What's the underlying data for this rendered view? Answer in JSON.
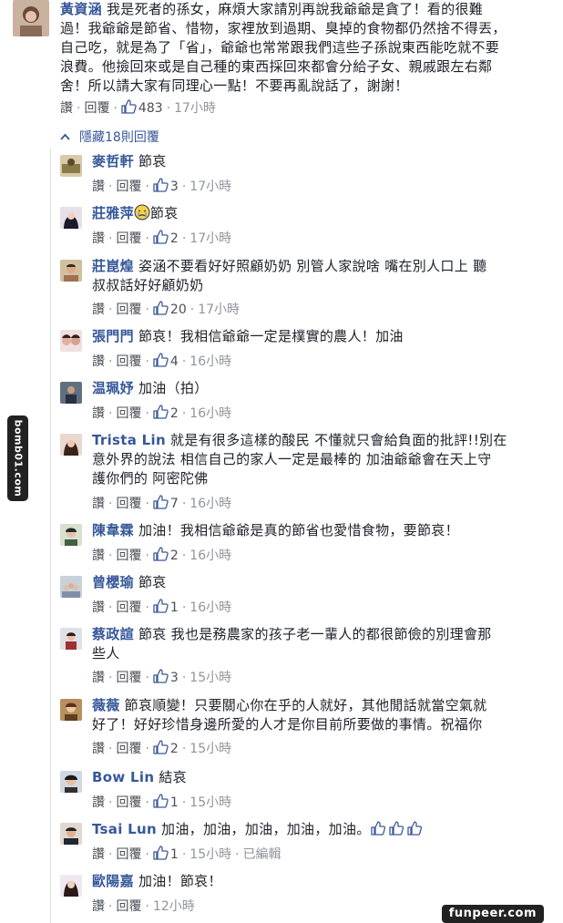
{
  "top_comment": {
    "name": "黃資涵",
    "text_line1": " 我是死者的孫女，麻煩大家請別再說我爺爺是貪了！看的很難",
    "text_line2": "過！我爺爺是節省、惜物，家裡放到過期、臭掉的食物都仍然捨不得丟，",
    "text_line3": "自己吃，就是為了「省」，爺爺也常常跟我們這些子孫說東西能吃就不要",
    "text_line4": "浪費。他撿回來或是自己種的東西採回來都會分給子女、親戚跟左右鄰",
    "text_line5": "舍！所以請大家有同理心一點！不要再亂說話了，謝謝！",
    "like_label": "讚",
    "reply_label": "回覆",
    "likes": "483",
    "time": "17小時"
  },
  "hide_replies_label": "隱藏18則回覆",
  "replies": [
    {
      "name": "麥哲軒",
      "lines": [
        " 節哀"
      ],
      "likes": "3",
      "time": "17小時"
    },
    {
      "name": "莊雅萍",
      "lines": [
        "節哀"
      ],
      "likes": "2",
      "time": "17小時"
    },
    {
      "name": "莊崑煌",
      "lines": [
        " 姿涵不要看好好照顧奶奶 別管人家說啥 嘴在別人口上 聽",
        "叔叔話好好顧奶奶"
      ],
      "likes": "20",
      "time": "17小時"
    },
    {
      "name": "張門門",
      "lines": [
        " 節哀！我相信爺爺一定是樸實的農人！加油"
      ],
      "likes": "4",
      "time": "16小時"
    },
    {
      "name": "温珮妤",
      "lines": [
        " 加油（拍）"
      ],
      "likes": "2",
      "time": "16小時"
    },
    {
      "name": "Trista Lin",
      "lines": [
        " 就是有很多這樣的酸民 不懂就只會給負面的批評!!別在",
        "意外界的說法 相信自己的家人一定是最棒的 加油爺爺會在天上守",
        "護你們的 阿密陀佛"
      ],
      "likes": "7",
      "time": "16小時"
    },
    {
      "name": "陳韋霖",
      "lines": [
        " 加油！我相信爺爺是真的節省也愛惜食物，要節哀！"
      ],
      "likes": "2",
      "time": "16小時"
    },
    {
      "name": "曾櫻瑜",
      "lines": [
        " 節哀"
      ],
      "likes": "1",
      "time": "16小時"
    },
    {
      "name": "蔡政諠",
      "lines": [
        " 節哀 我也是務農家的孩子老一輩人的都很節儉的別理會那",
        "些人"
      ],
      "likes": "3",
      "time": "15小時"
    },
    {
      "name": "薇薇",
      "lines": [
        " 節哀順變！只要關心你在乎的人就好，其他閒話就當空氣就",
        "好了！好好珍惜身邊所愛的人才是你目前所要做的事情。祝福你"
      ],
      "likes": "2",
      "time": "15小時"
    },
    {
      "name": "Bow Lin",
      "lines": [
        " 結哀"
      ],
      "likes": "1",
      "time": "15小時"
    },
    {
      "name": "Tsai Lun",
      "lines": [
        " 加油，加油，加油，加油，加油。"
      ],
      "likes": "1",
      "time": "15小時",
      "edited": "已編輯"
    },
    {
      "name": "歐陽嘉",
      "lines": [
        " 加油！節哀！"
      ],
      "likes": "",
      "time": "12小時"
    }
  ],
  "reply_like_label": "讚",
  "reply_reply_label": "回覆",
  "watermark_side": "bomb01.com",
  "watermark_bottom": "funpeer.com",
  "colors": {
    "link": "#365899",
    "meta": "#90949c",
    "text": "#1d2129"
  }
}
